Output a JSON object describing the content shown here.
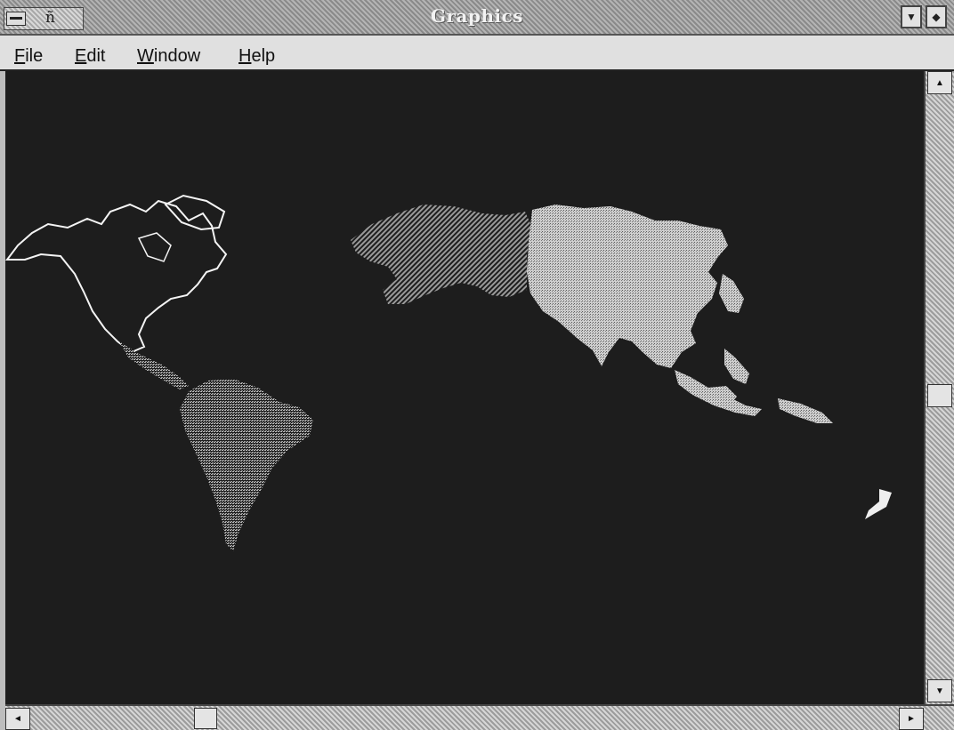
{
  "window": {
    "title": "Graphics",
    "system_menu_glyph": "ñ"
  },
  "menu": [
    {
      "mnemonic": "F",
      "rest": "ile"
    },
    {
      "mnemonic": "E",
      "rest": "dit"
    },
    {
      "mnemonic": "W",
      "rest": "indow"
    },
    {
      "mnemonic": "H",
      "rest": "elp"
    }
  ],
  "icons": {
    "minimize": "▼",
    "maximize": "◆",
    "scroll_up": "▲",
    "scroll_down": "▼",
    "scroll_left": "◄",
    "scroll_right": "►"
  },
  "colors": {
    "map_background": "#1d1d1d",
    "north_america_outline": "#f4f4f4",
    "south_america_fill": "#9a9a9a",
    "china_fill": "#d8d8d8",
    "russia_fill": "#7a7a7a"
  }
}
